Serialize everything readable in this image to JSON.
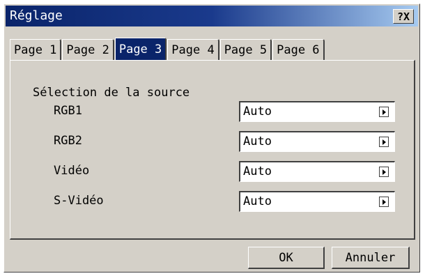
{
  "window": {
    "title": "Réglage",
    "help_label": "?X"
  },
  "tabs": [
    {
      "label": "Page 1",
      "active": false
    },
    {
      "label": "Page 2",
      "active": false
    },
    {
      "label": "Page 3",
      "active": true
    },
    {
      "label": "Page 4",
      "active": false
    },
    {
      "label": "Page 5",
      "active": false
    },
    {
      "label": "Page 6",
      "active": false
    }
  ],
  "panel": {
    "group_label": "Sélection de la source",
    "rows": [
      {
        "label": "RGB1",
        "value": "Auto"
      },
      {
        "label": "RGB2",
        "value": "Auto"
      },
      {
        "label": "Vidéo",
        "value": "Auto"
      },
      {
        "label": "S-Vidéo",
        "value": "Auto"
      }
    ]
  },
  "buttons": {
    "ok": "OK",
    "cancel": "Annuler"
  },
  "colors": {
    "title_bar": "#0a246a",
    "dialog_bg": "#d4d0c8",
    "active_tab": "#0a246a"
  }
}
